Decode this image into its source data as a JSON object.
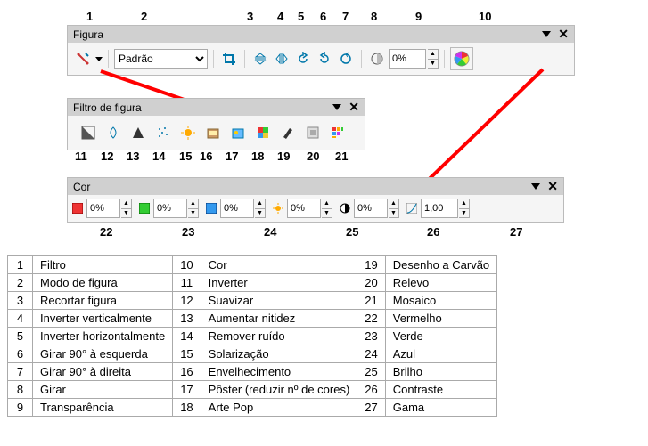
{
  "panels": {
    "figura": {
      "title": "Figura",
      "mode_value": "Padrão",
      "transparency": "0%"
    },
    "filtro": {
      "title": "Filtro de figura"
    },
    "cor": {
      "title": "Cor",
      "red": "0%",
      "green": "0%",
      "blue": "0%",
      "brightness": "0%",
      "contrast": "0%",
      "gamma": "1,00"
    }
  },
  "top_labels": [
    "1",
    "2",
    "3",
    "4",
    "5",
    "6",
    "7",
    "8",
    "9",
    "10"
  ],
  "mid_labels": [
    "11",
    "12",
    "13",
    "14",
    "15",
    "16",
    "17",
    "18",
    "19",
    "20",
    "21"
  ],
  "bottom_labels": [
    "22",
    "23",
    "24",
    "25",
    "26",
    "27"
  ],
  "legend": [
    {
      "n": "1",
      "t": "Filtro"
    },
    {
      "n": "2",
      "t": "Modo de figura"
    },
    {
      "n": "3",
      "t": "Recortar figura"
    },
    {
      "n": "4",
      "t": "Inverter verticalmente"
    },
    {
      "n": "5",
      "t": "Inverter horizontalmente"
    },
    {
      "n": "6",
      "t": "Girar 90° à esquerda"
    },
    {
      "n": "7",
      "t": "Girar 90° à direita"
    },
    {
      "n": "8",
      "t": "Girar"
    },
    {
      "n": "9",
      "t": "Transparência"
    },
    {
      "n": "10",
      "t": "Cor"
    },
    {
      "n": "11",
      "t": "Inverter"
    },
    {
      "n": "12",
      "t": "Suavizar"
    },
    {
      "n": "13",
      "t": "Aumentar nitidez"
    },
    {
      "n": "14",
      "t": "Remover ruído"
    },
    {
      "n": "15",
      "t": "Solarização"
    },
    {
      "n": "16",
      "t": "Envelhecimento"
    },
    {
      "n": "17",
      "t": "Pôster (reduzir nº de cores)"
    },
    {
      "n": "18",
      "t": "Arte Pop"
    },
    {
      "n": "19",
      "t": "Desenho a Carvão"
    },
    {
      "n": "20",
      "t": "Relevo"
    },
    {
      "n": "21",
      "t": "Mosaico"
    },
    {
      "n": "22",
      "t": "Vermelho"
    },
    {
      "n": "23",
      "t": "Verde"
    },
    {
      "n": "24",
      "t": "Azul"
    },
    {
      "n": "25",
      "t": "Brilho"
    },
    {
      "n": "26",
      "t": "Contraste"
    },
    {
      "n": "27",
      "t": "Gama"
    }
  ]
}
